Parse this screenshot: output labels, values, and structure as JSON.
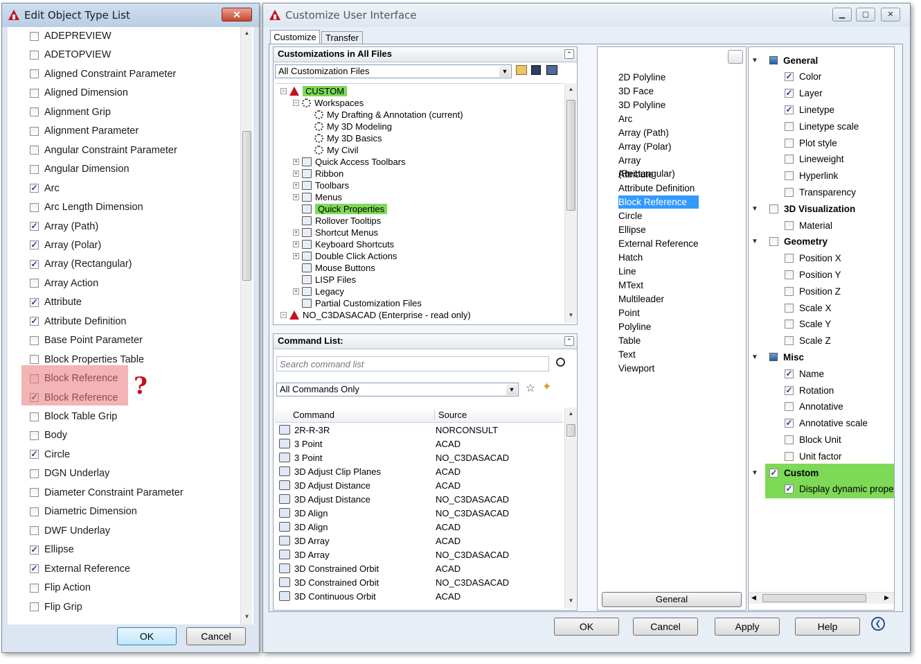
{
  "left_dialog": {
    "title": "Edit Object Type List",
    "close": "✕",
    "items": [
      {
        "label": "ADEPREVIEW",
        "checked": false
      },
      {
        "label": "ADETOPVIEW",
        "checked": false
      },
      {
        "label": "Aligned Constraint Parameter",
        "checked": false
      },
      {
        "label": "Aligned Dimension",
        "checked": false
      },
      {
        "label": "Alignment Grip",
        "checked": false
      },
      {
        "label": "Alignment Parameter",
        "checked": false
      },
      {
        "label": "Angular Constraint Parameter",
        "checked": false
      },
      {
        "label": "Angular Dimension",
        "checked": false
      },
      {
        "label": "Arc",
        "checked": true
      },
      {
        "label": "Arc Length Dimension",
        "checked": false
      },
      {
        "label": "Array (Path)",
        "checked": true
      },
      {
        "label": "Array (Polar)",
        "checked": true
      },
      {
        "label": "Array (Rectangular)",
        "checked": true
      },
      {
        "label": "Array Action",
        "checked": false
      },
      {
        "label": "Attribute",
        "checked": true
      },
      {
        "label": "Attribute Definition",
        "checked": true
      },
      {
        "label": "Base Point Parameter",
        "checked": false
      },
      {
        "label": "Block Properties Table",
        "checked": false
      },
      {
        "label": "Block Reference",
        "checked": false
      },
      {
        "label": "Block Reference",
        "checked": true
      },
      {
        "label": "Block Table Grip",
        "checked": false
      },
      {
        "label": "Body",
        "checked": false
      },
      {
        "label": "Circle",
        "checked": true
      },
      {
        "label": "DGN Underlay",
        "checked": false
      },
      {
        "label": "Diameter Constraint Parameter",
        "checked": false
      },
      {
        "label": "Diametric Dimension",
        "checked": false
      },
      {
        "label": "DWF Underlay",
        "checked": false
      },
      {
        "label": "Ellipse",
        "checked": true
      },
      {
        "label": "External Reference",
        "checked": true
      },
      {
        "label": "Flip Action",
        "checked": false
      },
      {
        "label": "Flip Grip",
        "checked": false
      }
    ],
    "question_mark": "?",
    "ok": "OK",
    "cancel": "Cancel"
  },
  "cui": {
    "title": "Customize User Interface",
    "tabs": [
      "Customize",
      "Transfer"
    ],
    "customizations_header": "Customizations in All Files",
    "files_combo": "All Customization Files",
    "tree": [
      {
        "label": "CUSTOM",
        "level": 0,
        "exp": "−",
        "icon": "red",
        "hl": true
      },
      {
        "label": "Workspaces",
        "level": 1,
        "exp": "−",
        "icon": "gear"
      },
      {
        "label": "My Drafting & Annotation (current)",
        "level": 2,
        "icon": "gear"
      },
      {
        "label": "My 3D Modeling",
        "level": 2,
        "icon": "gear"
      },
      {
        "label": "My 3D Basics",
        "level": 2,
        "icon": "gear"
      },
      {
        "label": "My Civil",
        "level": 2,
        "icon": "gear"
      },
      {
        "label": "Quick Access Toolbars",
        "level": 1,
        "exp": "+",
        "icon": "box"
      },
      {
        "label": "Ribbon",
        "level": 1,
        "exp": "+",
        "icon": "box"
      },
      {
        "label": "Toolbars",
        "level": 1,
        "exp": "+",
        "icon": "box"
      },
      {
        "label": "Menus",
        "level": 1,
        "exp": "+",
        "icon": "box"
      },
      {
        "label": "Quick Properties",
        "level": 1,
        "icon": "box",
        "hl": true
      },
      {
        "label": "Rollover Tooltips",
        "level": 1,
        "icon": "box"
      },
      {
        "label": "Shortcut Menus",
        "level": 1,
        "exp": "+",
        "icon": "box"
      },
      {
        "label": "Keyboard Shortcuts",
        "level": 1,
        "exp": "+",
        "icon": "box"
      },
      {
        "label": "Double Click Actions",
        "level": 1,
        "exp": "+",
        "icon": "box"
      },
      {
        "label": "Mouse Buttons",
        "level": 1,
        "icon": "box"
      },
      {
        "label": "LISP Files",
        "level": 1,
        "icon": "box"
      },
      {
        "label": "Legacy",
        "level": 1,
        "exp": "+",
        "icon": "box"
      },
      {
        "label": "Partial Customization Files",
        "level": 1,
        "icon": "box"
      },
      {
        "label": "NO_C3DASACAD (Enterprise - read only)",
        "level": 0,
        "exp": "−",
        "icon": "red"
      }
    ],
    "command_list_header": "Command List:",
    "search_placeholder": "Search command list",
    "commands_combo": "All Commands Only",
    "col_command": "Command",
    "col_source": "Source",
    "commands": [
      {
        "name": "2R-R-3R",
        "source": "NORCONSULT"
      },
      {
        "name": "3 Point",
        "source": "ACAD"
      },
      {
        "name": "3 Point",
        "source": "NO_C3DASACAD"
      },
      {
        "name": "3D Adjust Clip Planes",
        "source": "ACAD"
      },
      {
        "name": "3D Adjust Distance",
        "source": "ACAD"
      },
      {
        "name": "3D Adjust Distance",
        "source": "NO_C3DASACAD"
      },
      {
        "name": "3D Align",
        "source": "NO_C3DASACAD"
      },
      {
        "name": "3D Align",
        "source": "ACAD"
      },
      {
        "name": "3D Array",
        "source": "ACAD"
      },
      {
        "name": "3D Array",
        "source": "NO_C3DASACAD"
      },
      {
        "name": "3D Constrained Orbit",
        "source": "ACAD"
      },
      {
        "name": "3D Constrained Orbit",
        "source": "NO_C3DASACAD"
      },
      {
        "name": "3D Continuous Orbit",
        "source": "ACAD"
      }
    ],
    "object_types": [
      "2D Polyline",
      "3D Face",
      "3D Polyline",
      "Arc",
      "Array (Path)",
      "Array (Polar)",
      "Array (Rectangular)",
      "Attribute",
      "Attribute Definition",
      "Block Reference",
      "Circle",
      "Ellipse",
      "External Reference",
      "Hatch",
      "Line",
      "MText",
      "Multileader",
      "Point",
      "Polyline",
      "Table",
      "Text",
      "Viewport"
    ],
    "selected_object": "Block Reference",
    "general_button": "General",
    "props": [
      {
        "label": "General",
        "type": "group",
        "sq": true
      },
      {
        "label": "Color",
        "checked": true
      },
      {
        "label": "Layer",
        "checked": true
      },
      {
        "label": "Linetype",
        "checked": true
      },
      {
        "label": "Linetype scale",
        "checked": false
      },
      {
        "label": "Plot style",
        "checked": false
      },
      {
        "label": "Lineweight",
        "checked": false
      },
      {
        "label": "Hyperlink",
        "checked": false
      },
      {
        "label": "Transparency",
        "checked": false
      },
      {
        "label": "3D Visualization",
        "type": "group",
        "checked": false
      },
      {
        "label": "Material",
        "checked": false
      },
      {
        "label": "Geometry",
        "type": "group",
        "checked": false
      },
      {
        "label": "Position X",
        "checked": false
      },
      {
        "label": "Position Y",
        "checked": false
      },
      {
        "label": "Position Z",
        "checked": false
      },
      {
        "label": "Scale X",
        "checked": false
      },
      {
        "label": "Scale Y",
        "checked": false
      },
      {
        "label": "Scale Z",
        "checked": false
      },
      {
        "label": "Misc",
        "type": "group",
        "sq": true
      },
      {
        "label": "Name",
        "checked": true
      },
      {
        "label": "Rotation",
        "checked": true
      },
      {
        "label": "Annotative",
        "checked": false
      },
      {
        "label": "Annotative scale",
        "checked": true
      },
      {
        "label": "Block Unit",
        "checked": false
      },
      {
        "label": "Unit factor",
        "checked": false
      },
      {
        "label": "Custom",
        "type": "group",
        "checked": true
      },
      {
        "label": "Display dynamic prope",
        "checked": true
      }
    ],
    "buttons": {
      "ok": "OK",
      "cancel": "Cancel",
      "apply": "Apply",
      "help": "Help"
    }
  }
}
